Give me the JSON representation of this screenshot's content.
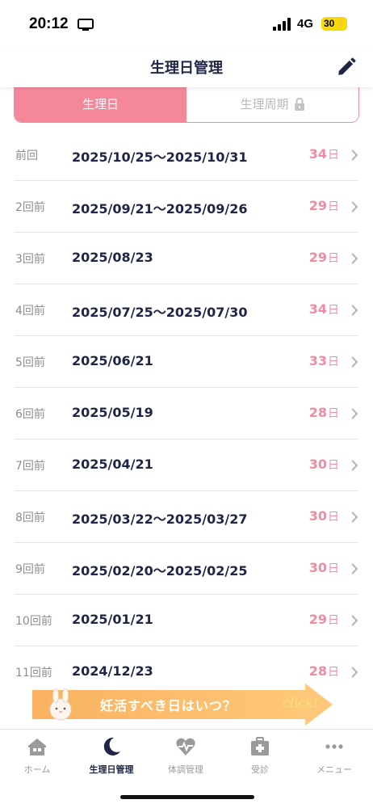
{
  "status_bar": {
    "time": "20:12",
    "network": "4G",
    "battery": "30"
  },
  "nav": {
    "title": "生理日管理",
    "edit_icon": "pencil-icon"
  },
  "segment": {
    "tabs": [
      {
        "label": "生理日",
        "active": true
      },
      {
        "label": "生理周期",
        "active": false,
        "icon": "lock-icon"
      }
    ]
  },
  "history": [
    {
      "label": "前回",
      "date": "2025/10/25～2025/10/31",
      "days": "34",
      "unit": "日"
    },
    {
      "label": "2回前",
      "date": "2025/09/21～2025/09/26",
      "days": "29",
      "unit": "日"
    },
    {
      "label": "3回前",
      "date": "2025/08/23",
      "days": "29",
      "unit": "日"
    },
    {
      "label": "4回前",
      "date": "2025/07/25～2025/07/30",
      "days": "34",
      "unit": "日"
    },
    {
      "label": "5回前",
      "date": "2025/06/21",
      "days": "33",
      "unit": "日"
    },
    {
      "label": "6回前",
      "date": "2025/05/19",
      "days": "28",
      "unit": "日"
    },
    {
      "label": "7回前",
      "date": "2025/04/21",
      "days": "30",
      "unit": "日"
    },
    {
      "label": "8回前",
      "date": "2025/03/22～2025/03/27",
      "days": "30",
      "unit": "日"
    },
    {
      "label": "9回前",
      "date": "2025/02/20～2025/02/25",
      "days": "30",
      "unit": "日"
    },
    {
      "label": "10回前",
      "date": "2025/01/21",
      "days": "29",
      "unit": "日"
    },
    {
      "label": "11回前",
      "date": "2024/12/23",
      "days": "28",
      "unit": "日"
    }
  ],
  "banner": {
    "text": "妊活すべき日はいつ？",
    "click_text": "click!"
  },
  "tabbar": {
    "items": [
      {
        "label": "ホーム",
        "icon": "home-icon",
        "active": false
      },
      {
        "label": "生理日管理",
        "icon": "moon-icon",
        "active": true
      },
      {
        "label": "体調管理",
        "icon": "heart-pulse-icon",
        "active": false
      },
      {
        "label": "受診",
        "icon": "medical-kit-icon",
        "active": false
      },
      {
        "label": "メニュー",
        "icon": "more-icon",
        "active": false
      }
    ]
  },
  "colors": {
    "accent": "#f5879b",
    "text_dark": "#1f2544",
    "banner": "#ffc779"
  }
}
